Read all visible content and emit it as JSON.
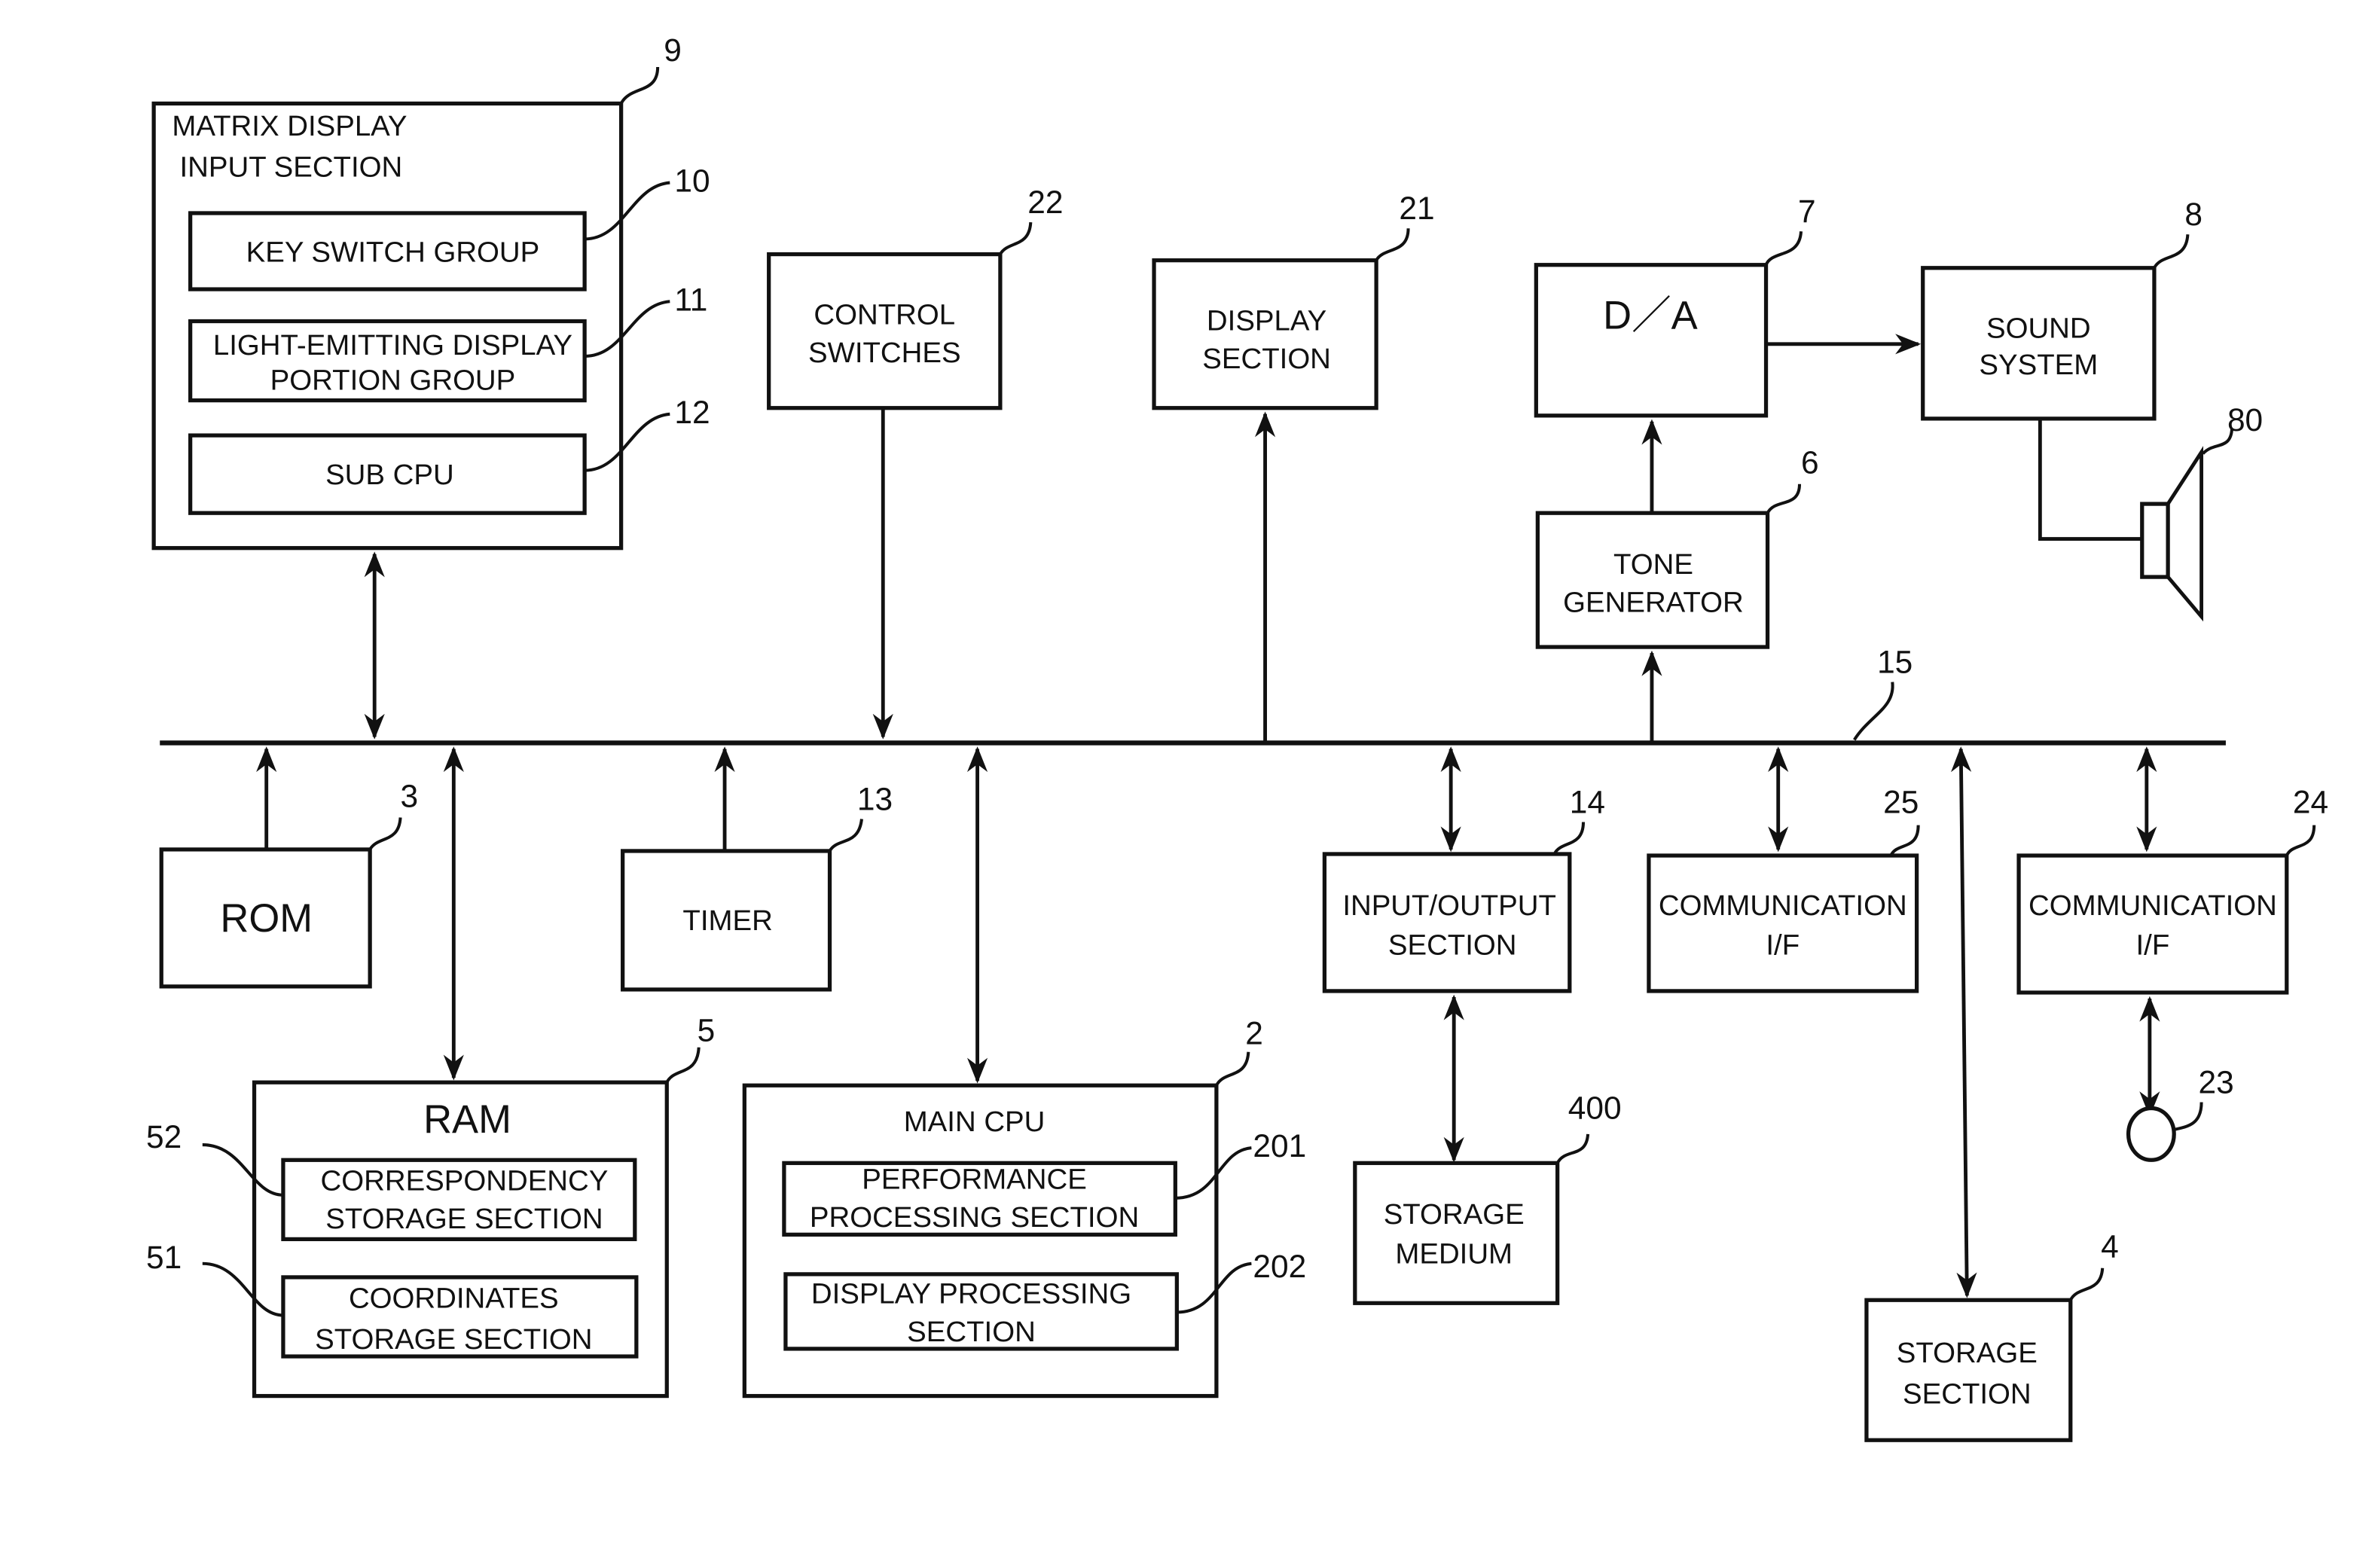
{
  "figure": {
    "bus_ref": "15",
    "blocks": {
      "matrix_input": {
        "ref": "9",
        "lines": [
          "MATRIX DISPLAY",
          "INPUT SECTION"
        ]
      },
      "key_switch": {
        "ref": "10",
        "lines": [
          "KEY SWITCH GROUP"
        ]
      },
      "light_emitting": {
        "ref": "11",
        "lines": [
          "LIGHT-EMITTING DISPLAY",
          "PORTION GROUP"
        ]
      },
      "sub_cpu": {
        "ref": "12",
        "lines": [
          "SUB CPU"
        ]
      },
      "control_switches": {
        "ref": "22",
        "lines": [
          "CONTROL",
          "SWITCHES"
        ]
      },
      "display_section": {
        "ref": "21",
        "lines": [
          "DISPLAY",
          "SECTION"
        ]
      },
      "da": {
        "ref": "7",
        "lines": [
          "D／A"
        ]
      },
      "sound_system": {
        "ref": "8",
        "lines": [
          "SOUND",
          "SYSTEM"
        ]
      },
      "speaker": {
        "ref": "80"
      },
      "tone_generator": {
        "ref": "6",
        "lines": [
          "TONE",
          "GENERATOR"
        ]
      },
      "rom": {
        "ref": "3",
        "lines": [
          "ROM"
        ]
      },
      "timer": {
        "ref": "13",
        "lines": [
          "TIMER"
        ]
      },
      "io_section": {
        "ref": "14",
        "lines": [
          "INPUT/OUTPUT",
          "SECTION"
        ]
      },
      "comm_if_25": {
        "ref": "25",
        "lines": [
          "COMMUNICATION",
          "I/F"
        ]
      },
      "comm_if_24": {
        "ref": "24",
        "lines": [
          "COMMUNICATION",
          "I/F"
        ]
      },
      "terminal": {
        "ref": "23"
      },
      "ram": {
        "ref": "5",
        "lines": [
          "RAM"
        ]
      },
      "correspondency": {
        "ref": "52",
        "lines": [
          "CORRESPONDENCY",
          "STORAGE SECTION"
        ]
      },
      "coordinates": {
        "ref": "51",
        "lines": [
          "COORDINATES",
          "STORAGE SECTION"
        ]
      },
      "main_cpu": {
        "ref": "2",
        "lines": [
          "MAIN CPU"
        ]
      },
      "performance": {
        "ref": "201",
        "lines": [
          "PERFORMANCE",
          "PROCESSING SECTION"
        ]
      },
      "display_processing": {
        "ref": "202",
        "lines": [
          "DISPLAY PROCESSING",
          "SECTION"
        ]
      },
      "storage_medium": {
        "ref": "400",
        "lines": [
          "STORAGE",
          "MEDIUM"
        ]
      },
      "storage_section": {
        "ref": "4",
        "lines": [
          "STORAGE",
          "SECTION"
        ]
      }
    }
  }
}
